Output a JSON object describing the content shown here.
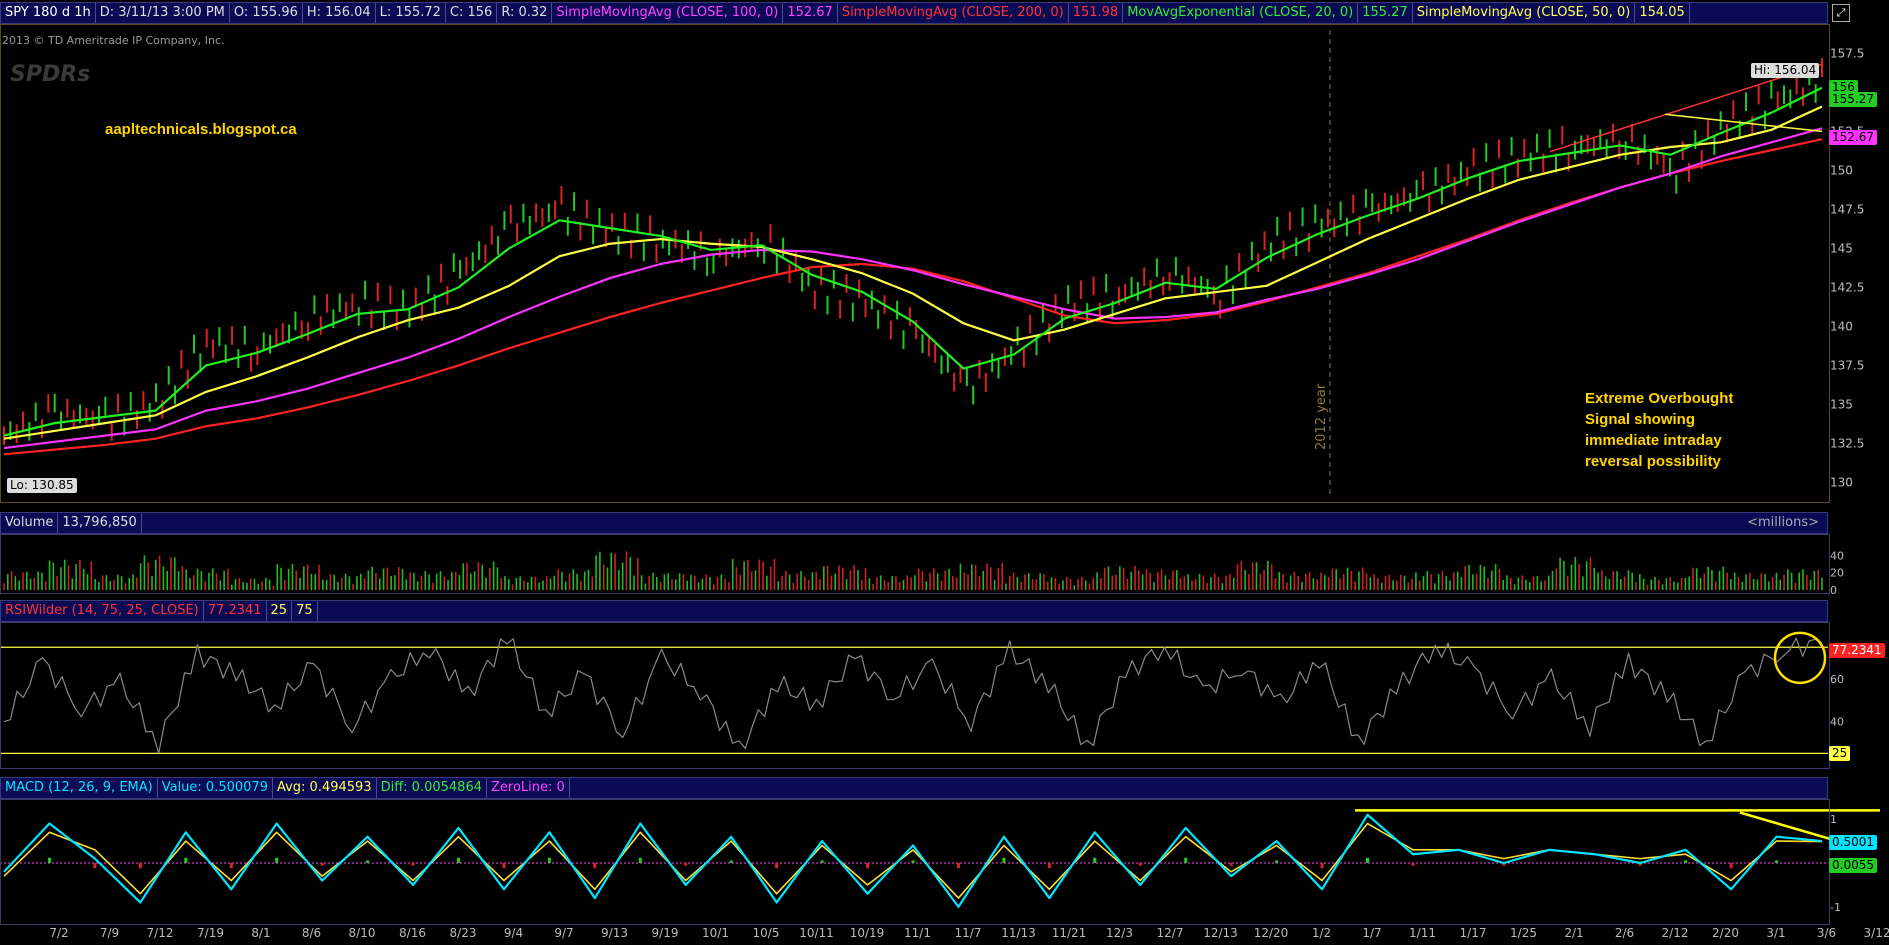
{
  "price_header": {
    "symbol": "SPY 180 d 1h",
    "date": "D: 3/11/13 3:00 PM",
    "open": "O: 155.96",
    "high": "H: 156.04",
    "low": "L: 155.72",
    "close": "C: 156",
    "range": "R: 0.32",
    "sma100_label": "SimpleMovingAvg (CLOSE, 100, 0)",
    "sma100_value": "152.67",
    "sma200_label": "SimpleMovingAvg (CLOSE, 200, 0)",
    "sma200_value": "151.98",
    "ema20_label": "MovAvgExponential (CLOSE, 20, 0)",
    "ema20_value": "155.27",
    "sma50_label": "SimpleMovingAvg (CLOSE, 50, 0)",
    "sma50_value": "154.05"
  },
  "copyright": "2013 © TD Ameritrade IP Company, Inc.",
  "logo_text": "SPDRs",
  "blog": "aapltechnicals.blogspot.ca",
  "annotation": [
    "Extreme Overbought",
    "Signal showing",
    "immediate intraday",
    "reversal possibility"
  ],
  "year_marker": "2012 year",
  "hi_label": "Hi: 156.04",
  "lo_label": "Lo: 130.85",
  "price_tags": {
    "last": "156",
    "ema": "155.27",
    "sma100": "152.67"
  },
  "volume_header": {
    "label": "Volume",
    "value": "13,796,850",
    "unit": "<millions>"
  },
  "rsi_header": {
    "label": "RSIWilder (14, 75, 25, CLOSE)",
    "value": "77.2341",
    "low": "25",
    "high": "75"
  },
  "rsi_tags": {
    "value": "77.2341",
    "low": "25"
  },
  "macd_header": {
    "label": "MACD (12, 26, 9, EMA)",
    "value": "Value: 0.500079",
    "avg": "Avg: 0.494593",
    "diff": "Diff: 0.0054864",
    "zero": "ZeroLine: 0"
  },
  "macd_tags": {
    "value": "0.5001",
    "diff": "0.0055"
  },
  "colors": {
    "sma100": "#ff33ff",
    "sma200": "#ff2222",
    "ema20": "#22ee22",
    "sma50": "#ffff44",
    "macd": "#00e5ff",
    "annotation": "#ffd400"
  },
  "chart_data": [
    {
      "type": "line",
      "title": "SPY 180 d 1h",
      "x": [
        "7/2",
        "7/9",
        "7/12",
        "7/19",
        "8/1",
        "8/6",
        "8/10",
        "8/16",
        "8/23",
        "9/4",
        "9/7",
        "9/13",
        "9/19",
        "10/1",
        "10/5",
        "10/11",
        "10/19",
        "11/1",
        "11/7",
        "11/13",
        "11/21",
        "12/3",
        "12/7",
        "12/13",
        "12/20",
        "1/2",
        "1/7",
        "1/11",
        "1/17",
        "1/25",
        "2/1",
        "2/6",
        "2/12",
        "2/20",
        "3/1",
        "3/6",
        "3/12"
      ],
      "ylim": [
        129,
        159
      ],
      "yticks": [
        "157.5",
        "155",
        "152.5",
        "150",
        "147.5",
        "145",
        "142.5",
        "140",
        "137.5",
        "135",
        "132.5",
        "130"
      ],
      "series": [
        {
          "name": "Close",
          "values": [
            133,
            134.5,
            134,
            135,
            139,
            138.5,
            140.5,
            141.5,
            141,
            143.5,
            146.5,
            147.5,
            146,
            145.5,
            144.5,
            145.5,
            142.5,
            141.5,
            139.5,
            136,
            138.5,
            141.5,
            142,
            143.5,
            142,
            145.5,
            146.5,
            147.5,
            148.5,
            150,
            151,
            151.5,
            152,
            150,
            153,
            154.5,
            156
          ]
        },
        {
          "name": "MovAvgExponential (CLOSE, 20, 0)",
          "values": [
            133,
            133.8,
            134.2,
            134.6,
            137.5,
            138.3,
            139.5,
            140.8,
            141.1,
            142.5,
            145,
            146.8,
            146.3,
            145.8,
            144.9,
            145.2,
            143.3,
            142.2,
            140.3,
            137.3,
            138.2,
            140.5,
            141.5,
            142.8,
            142.4,
            144.4,
            145.9,
            147.1,
            148.2,
            149.5,
            150.6,
            151.1,
            151.6,
            151,
            152.4,
            153.7,
            155.3
          ]
        },
        {
          "name": "SimpleMovingAvg (CLOSE, 50, 0)",
          "values": [
            132.8,
            133.3,
            133.8,
            134.3,
            135.8,
            136.8,
            138,
            139.3,
            140.4,
            141.2,
            142.6,
            144.5,
            145.3,
            145.6,
            145.3,
            145.1,
            144.3,
            143.4,
            142.1,
            140.2,
            139.1,
            139.8,
            140.8,
            141.8,
            142.2,
            142.6,
            144.1,
            145.6,
            146.9,
            148.2,
            149.4,
            150.2,
            151,
            151.5,
            151.8,
            152.6,
            154.1
          ]
        },
        {
          "name": "SimpleMovingAvg (CLOSE, 100, 0)",
          "values": [
            132.2,
            132.6,
            133,
            133.4,
            134.6,
            135.2,
            136,
            137,
            138,
            139.2,
            140.6,
            141.9,
            143.1,
            144,
            144.6,
            144.9,
            144.8,
            144.3,
            143.6,
            142.7,
            141.9,
            141.1,
            140.5,
            140.6,
            140.9,
            141.7,
            142.4,
            143.3,
            144.3,
            145.5,
            146.7,
            147.8,
            148.9,
            149.8,
            150.9,
            151.8,
            152.7
          ]
        },
        {
          "name": "SimpleMovingAvg (CLOSE, 200, 0)",
          "values": [
            131.8,
            132.1,
            132.4,
            132.8,
            133.6,
            134.1,
            134.8,
            135.6,
            136.5,
            137.5,
            138.6,
            139.6,
            140.6,
            141.5,
            142.3,
            143.1,
            143.8,
            144,
            143.7,
            142.9,
            141.8,
            140.7,
            140.2,
            140.4,
            140.8,
            141.6,
            142.5,
            143.4,
            144.5,
            145.6,
            146.8,
            147.9,
            148.9,
            149.8,
            150.6,
            151.3,
            152
          ]
        }
      ]
    },
    {
      "type": "bar",
      "title": "Volume",
      "ylabel": "<millions>",
      "ylim": [
        0,
        60
      ],
      "yticks": [
        "40",
        "20",
        "0"
      ],
      "values": [
        22,
        35,
        18,
        40,
        25,
        14,
        30,
        19,
        27,
        22,
        33,
        16,
        24,
        45,
        20,
        18,
        36,
        22,
        29,
        17,
        25,
        31,
        20,
        15,
        28,
        24,
        19,
        34,
        21,
        26,
        18,
        22,
        30,
        17,
        38,
        23,
        15,
        27,
        20,
        24
      ]
    },
    {
      "type": "line",
      "title": "RSIWilder (14, 75, 25, CLOSE)",
      "ylim": [
        20,
        85
      ],
      "yticks": [
        "60",
        "40"
      ],
      "series": [
        {
          "name": "RSIWilder (14, 75, 25, CLOSE)",
          "values": [
            40,
            68,
            46,
            58,
            30,
            72,
            62,
            47,
            66,
            38,
            60,
            75,
            52,
            80,
            44,
            62,
            35,
            70,
            55,
            26,
            58,
            48,
            70,
            52,
            66,
            40,
            73,
            58,
            28,
            62,
            76,
            54,
            66,
            48,
            70,
            30,
            55,
            76,
            64,
            45,
            60,
            38,
            68,
            52,
            30,
            62,
            74,
            77
          ]
        }
      ]
    },
    {
      "type": "line",
      "title": "MACD (12, 26, 9, EMA)",
      "ylim": [
        -1.3,
        1.3
      ],
      "yticks": [
        "1",
        "-1"
      ],
      "series": [
        {
          "name": "Value",
          "values": [
            -0.2,
            0.9,
            0.1,
            -0.9,
            0.7,
            -0.6,
            0.9,
            -0.4,
            0.6,
            -0.5,
            0.8,
            -0.6,
            0.7,
            -0.8,
            0.9,
            -0.5,
            0.6,
            -0.9,
            0.5,
            -0.7,
            0.4,
            -1.0,
            0.6,
            -0.8,
            0.7,
            -0.5,
            0.8,
            -0.3,
            0.5,
            -0.6,
            1.1,
            0.2,
            0.3,
            0.0,
            0.3,
            0.2,
            0.0,
            0.3,
            -0.6,
            0.6,
            0.5
          ]
        },
        {
          "name": "Avg",
          "values": [
            -0.3,
            0.7,
            0.3,
            -0.7,
            0.5,
            -0.4,
            0.7,
            -0.3,
            0.5,
            -0.4,
            0.6,
            -0.4,
            0.5,
            -0.6,
            0.7,
            -0.4,
            0.5,
            -0.7,
            0.4,
            -0.5,
            0.3,
            -0.8,
            0.4,
            -0.6,
            0.5,
            -0.4,
            0.6,
            -0.2,
            0.4,
            -0.4,
            0.9,
            0.3,
            0.3,
            0.1,
            0.3,
            0.2,
            0.1,
            0.2,
            -0.4,
            0.5,
            0.49
          ]
        }
      ]
    }
  ]
}
